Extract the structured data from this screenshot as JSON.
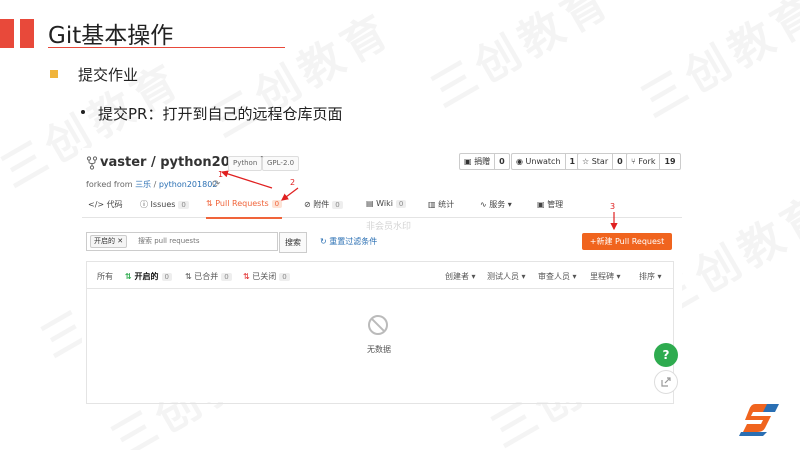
{
  "watermark": "三创教育",
  "slide": {
    "title": "Git基本操作",
    "bullet_level1": "提交作业",
    "bullet_level2": "提交PR：打开到自己的远程仓库页面"
  },
  "repo": {
    "name": "vaster / python201802",
    "badges": [
      "Python",
      "GPL-2.0"
    ],
    "forked_prefix": "forked from",
    "forked_owner": "三乐",
    "forked_repo": "python201802",
    "actions": [
      {
        "label": "捐赠",
        "count": "0"
      },
      {
        "label": "Unwatch",
        "count": "1"
      },
      {
        "label": "Star",
        "count": "0"
      },
      {
        "label": "Fork",
        "count": "19"
      }
    ]
  },
  "tabs": [
    {
      "label": "代码",
      "count": ""
    },
    {
      "label": "Issues",
      "count": "0"
    },
    {
      "label": "Pull Requests",
      "count": "0"
    },
    {
      "label": "附件",
      "count": "0"
    },
    {
      "label": "Wiki",
      "count": "0"
    },
    {
      "label": "统计",
      "count": ""
    },
    {
      "label": "服务",
      "count": ""
    },
    {
      "label": "管理",
      "count": ""
    }
  ],
  "overlay_text": "非会员水印",
  "filter": {
    "chip_label": "开启的",
    "search_placeholder": "搜索 pull requests",
    "search_button": "搜索",
    "reset_label": "重置过滤条件",
    "new_pr_button": "+新建 Pull Request"
  },
  "list": {
    "filter_tabs": [
      {
        "label": "所有",
        "count": ""
      },
      {
        "label": "开启的",
        "count": "0"
      },
      {
        "label": "已合并",
        "count": "0"
      },
      {
        "label": "已关闭",
        "count": "0"
      }
    ],
    "dropdowns": [
      "创建者",
      "测试人员",
      "审查人员",
      "里程碑",
      "排序"
    ],
    "empty_text": "无数据"
  },
  "annotations": [
    "1",
    "2",
    "3"
  ],
  "floating": {
    "help_label": "?"
  },
  "colors": {
    "accent": "#e8493a",
    "brand_orange": "#f0641e",
    "link_blue": "#2a6fb3",
    "help_green": "#2eab4f",
    "arrow_red": "#e02020"
  }
}
